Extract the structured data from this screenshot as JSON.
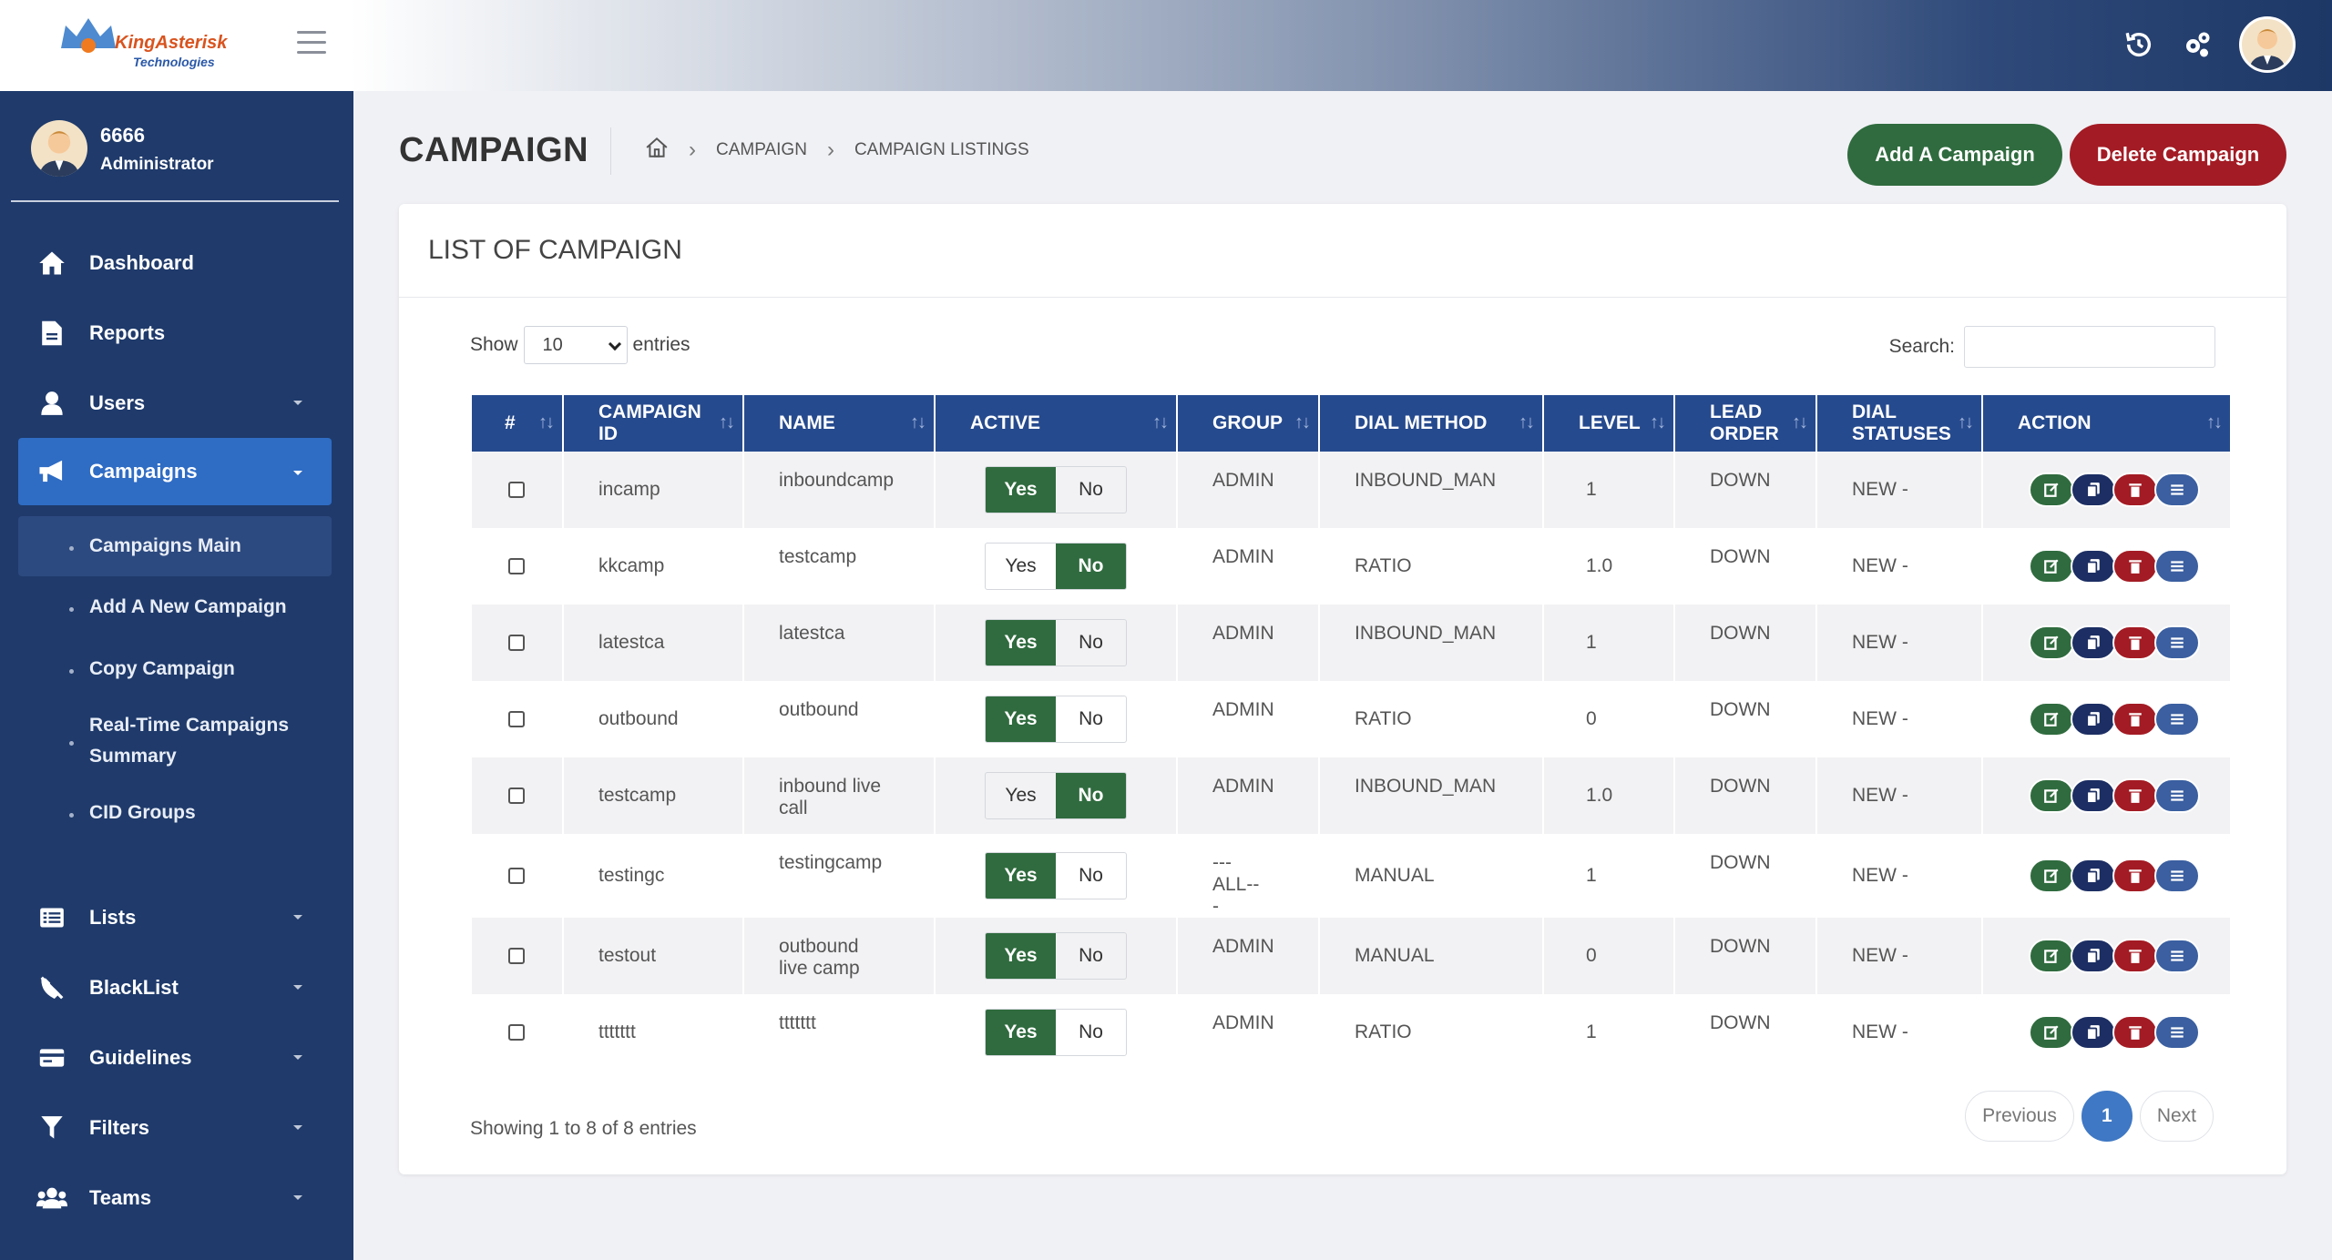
{
  "brand": {
    "name": "KingAsterisk",
    "sub": "Technologies"
  },
  "user": {
    "id": "6666",
    "role": "Administrator"
  },
  "nav": [
    {
      "label": "Dashboard",
      "icon": "home-icon",
      "caret": false
    },
    {
      "label": "Reports",
      "icon": "document-icon",
      "caret": false
    },
    {
      "label": "Users",
      "icon": "user-icon",
      "caret": true
    },
    {
      "label": "Campaigns",
      "icon": "megaphone-icon",
      "caret": true,
      "active": true
    }
  ],
  "subnav": [
    {
      "label": "Campaigns Main",
      "active": true
    },
    {
      "label": "Add A New Campaign"
    },
    {
      "label": "Copy Campaign"
    },
    {
      "label": "Real-Time Campaigns Summary"
    },
    {
      "label": "CID Groups"
    }
  ],
  "nav2": [
    {
      "label": "Lists",
      "icon": "list-icon"
    },
    {
      "label": "BlackList",
      "icon": "blocked-phone-icon"
    },
    {
      "label": "Guidelines",
      "icon": "card-icon"
    },
    {
      "label": "Filters",
      "icon": "filter-icon"
    },
    {
      "label": "Teams",
      "icon": "team-icon"
    }
  ],
  "page": {
    "title": "CAMPAIGN",
    "breadcrumb": [
      "CAMPAIGN",
      "CAMPAIGN LISTINGS"
    ],
    "add_label": "Add A Campaign",
    "delete_label": "Delete Campaign"
  },
  "card": {
    "title": "LIST OF CAMPAIGN",
    "show_label": "Show",
    "show_value": "10",
    "entries_label": "entries",
    "search_label": "Search:",
    "info": "Showing 1 to 8 of 8 entries",
    "prev": "Previous",
    "page": "1",
    "next": "Next"
  },
  "columns": [
    "#",
    "CAMPAIGN ID",
    "NAME",
    "ACTIVE",
    "GROUP",
    "DIAL METHOD",
    "LEVEL",
    "LEAD ORDER",
    "DIAL STATUSES",
    "ACTION"
  ],
  "toggle": {
    "yes": "Yes",
    "no": "No"
  },
  "rows": [
    {
      "id": "incamp",
      "name": "inboundcamp",
      "active": "Yes",
      "group": "ADMIN",
      "method": "INBOUND_MAN",
      "level": "1",
      "order": "DOWN",
      "statuses": "NEW -"
    },
    {
      "id": "kkcamp",
      "name": "testcamp",
      "active": "No",
      "group": "ADMIN",
      "method": "RATIO",
      "level": "1.0",
      "order": "DOWN",
      "statuses": "NEW -"
    },
    {
      "id": "latestca",
      "name": "latestca",
      "active": "Yes",
      "group": "ADMIN",
      "method": "INBOUND_MAN",
      "level": "1",
      "order": "DOWN",
      "statuses": "NEW -"
    },
    {
      "id": "outbound",
      "name": "outbound",
      "active": "Yes",
      "group": "ADMIN",
      "method": "RATIO",
      "level": "0",
      "order": "DOWN",
      "statuses": "NEW -"
    },
    {
      "id": "testcamp",
      "name": "inbound live call",
      "active": "No",
      "group": "ADMIN",
      "method": "INBOUND_MAN",
      "level": "1.0",
      "order": "DOWN",
      "statuses": "NEW -"
    },
    {
      "id": "testingc",
      "name": "testingcamp",
      "active": "Yes",
      "group": "---ALL-- -",
      "method": "MANUAL",
      "level": "1",
      "order": "DOWN",
      "statuses": "NEW -"
    },
    {
      "id": "testout",
      "name": "outbound live camp",
      "active": "Yes",
      "group": "ADMIN",
      "method": "MANUAL",
      "level": "0",
      "order": "DOWN",
      "statuses": "NEW -"
    },
    {
      "id": "ttttttt",
      "name": "ttttttt",
      "active": "Yes",
      "group": "ADMIN",
      "method": "RATIO",
      "level": "1",
      "order": "DOWN",
      "statuses": "NEW -"
    }
  ],
  "colors": {
    "sidebar": "#1f3a6b",
    "accent": "#2f6cc4",
    "yes": "#2f6b3e",
    "danger": "#a31b24",
    "header": "#264a8e"
  }
}
